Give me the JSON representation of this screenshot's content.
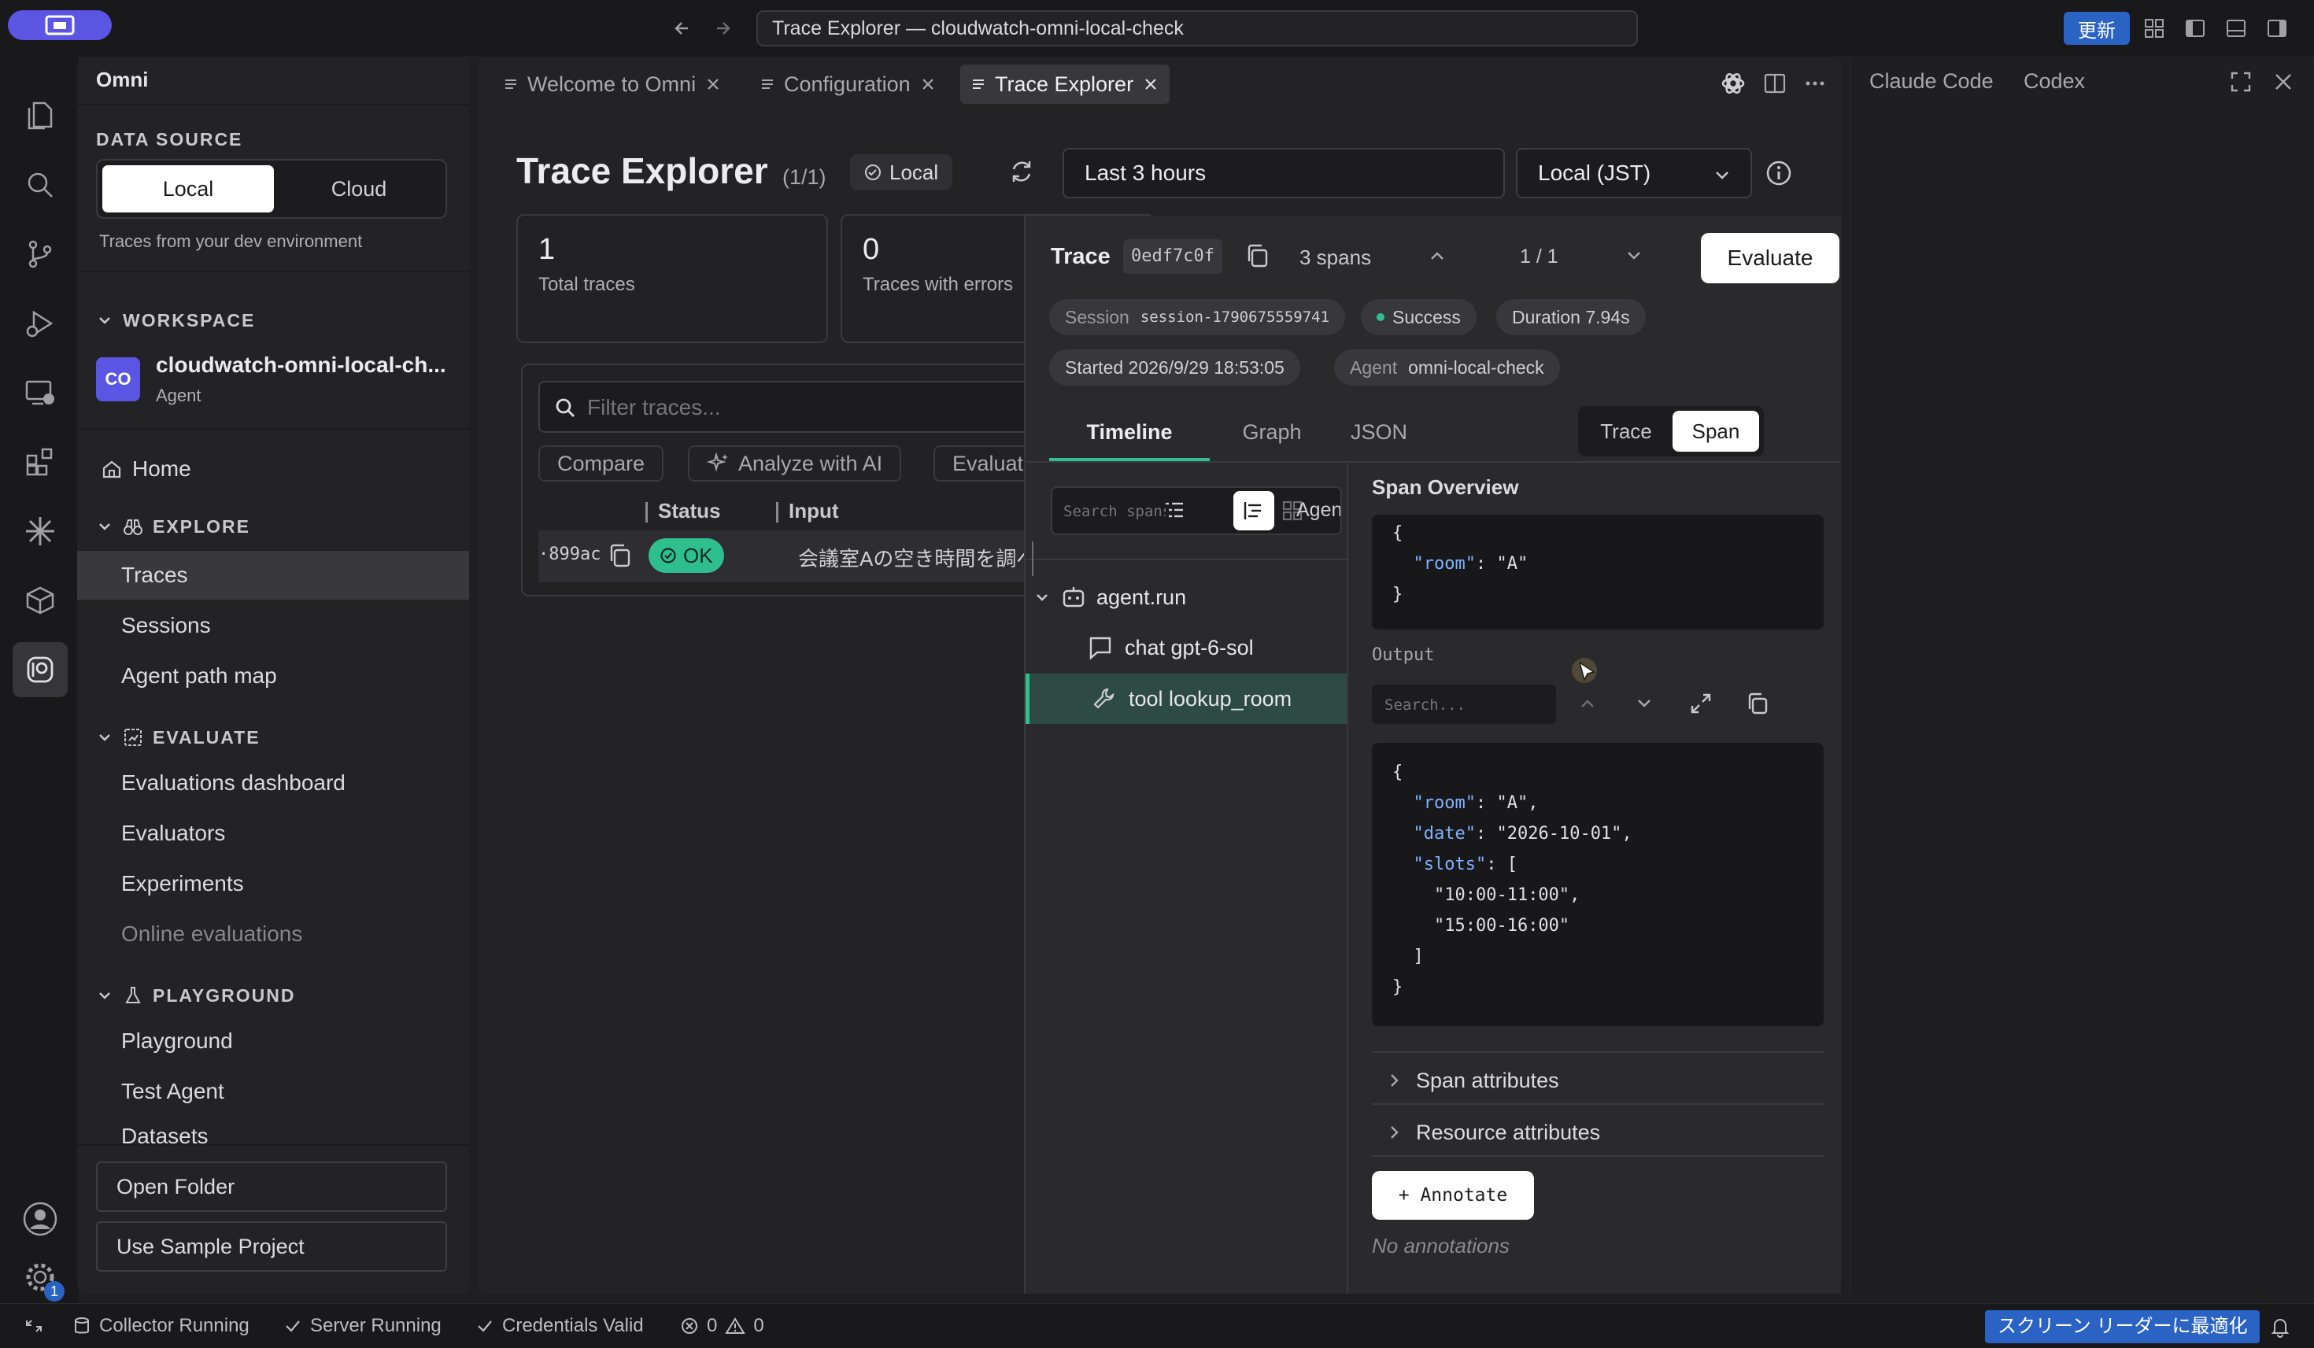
{
  "window": {
    "address": "Trace Explorer — cloudwatch-omni-local-check",
    "update_label": "更新"
  },
  "sidebar": {
    "app_name": "Omni",
    "data_source_heading": "DATA SOURCE",
    "source_options": [
      "Local",
      "Cloud"
    ],
    "source_selected": "Local",
    "source_note": "Traces from your dev environment",
    "workspace_heading": "WORKSPACE",
    "workspace": {
      "initials": "CO",
      "name": "cloudwatch-omni-local-ch...",
      "type": "Agent"
    },
    "home": "Home",
    "explore": {
      "heading": "EXPLORE",
      "items": [
        "Traces",
        "Sessions",
        "Agent path map"
      ],
      "selected": "Traces"
    },
    "evaluate": {
      "heading": "EVALUATE",
      "items": [
        "Evaluations dashboard",
        "Evaluators",
        "Experiments",
        "Online evaluations"
      ]
    },
    "playground": {
      "heading": "PLAYGROUND",
      "items": [
        "Playground",
        "Test Agent",
        "Datasets"
      ]
    },
    "open_folder": "Open Folder",
    "use_sample": "Use Sample Project",
    "settings_badge": "1"
  },
  "tabs": [
    {
      "label": "Welcome to Omni"
    },
    {
      "label": "Configuration"
    },
    {
      "label": "Trace Explorer"
    }
  ],
  "explorer": {
    "title": "Trace Explorer",
    "count": "(1/1)",
    "scope_badge": "Local",
    "time_range": "Last 3 hours",
    "timezone": "Local (JST)",
    "stats": [
      {
        "value": "1",
        "label": "Total traces"
      },
      {
        "value": "0",
        "label": "Traces with errors"
      }
    ],
    "filter_placeholder": "Filter traces...",
    "actions": [
      "Compare",
      "Analyze with AI",
      "Evaluat"
    ],
    "columns": [
      "Status",
      "Input"
    ],
    "rows": [
      {
        "id": "·899ac",
        "status": "OK",
        "input": "会議室Aの空き時間を調べ"
      }
    ]
  },
  "trace": {
    "label": "Trace",
    "id": "0edf7c0f",
    "spans": "3 spans",
    "pager": "1 / 1",
    "evaluate_label": "Evaluate",
    "session_key": "Session",
    "session_value": "session-1790675559741",
    "status": "Success",
    "duration": "Duration 7.94s",
    "started": "Started 2026/9/29 18:53:05",
    "agent_key": "Agent",
    "agent_value": "omni-local-check",
    "view_tabs": [
      "Timeline",
      "Graph",
      "JSON"
    ],
    "view_selected": "Timeline",
    "mode_options": [
      "Trace",
      "Span"
    ],
    "mode_selected": "Span",
    "span_search_placeholder": "Search spans...",
    "agent_filter": "Agent +",
    "tree": [
      {
        "label": "agent.run",
        "icon": "robot-icon"
      },
      {
        "label": "chat gpt-6-sol",
        "icon": "chat-bubble-icon"
      },
      {
        "label": "tool lookup_room",
        "icon": "wrench-icon"
      }
    ],
    "span_overview_label": "Span Overview",
    "input_json": {
      "l1": "{",
      "key": "\"room\"",
      "val": "\"A\"",
      "l3": "}"
    },
    "output_label": "Output",
    "output_search_placeholder": "Search...",
    "output_json": {
      "open": "{",
      "k_room": "\"room\"",
      "v_room": "\"A\",",
      "k_date": "\"date\"",
      "v_date": "\"2026-10-01\",",
      "k_slots": "\"slots\"",
      "v_slots_open": "[",
      "slot1": "\"10:00-11:00\",",
      "slot2": "\"15:00-16:00\"",
      "slots_close": "]",
      "close": "}"
    },
    "span_attributes": "Span attributes",
    "resource_attributes": "Resource attributes",
    "annotate": "+ Annotate",
    "no_annotations": "No annotations"
  },
  "right_panel": {
    "tabs": [
      "Claude Code",
      "Codex"
    ]
  },
  "status": {
    "collector": "Collector Running",
    "server": "Server Running",
    "credentials": "Credentials Valid",
    "errors": "0",
    "warnings": "0",
    "screen_reader": "スクリーン リーダーに最適化"
  },
  "colors": {
    "accent_purple": "#5b55e3",
    "ok_green": "#2fbf8f",
    "update_blue": "#2b63c4"
  }
}
